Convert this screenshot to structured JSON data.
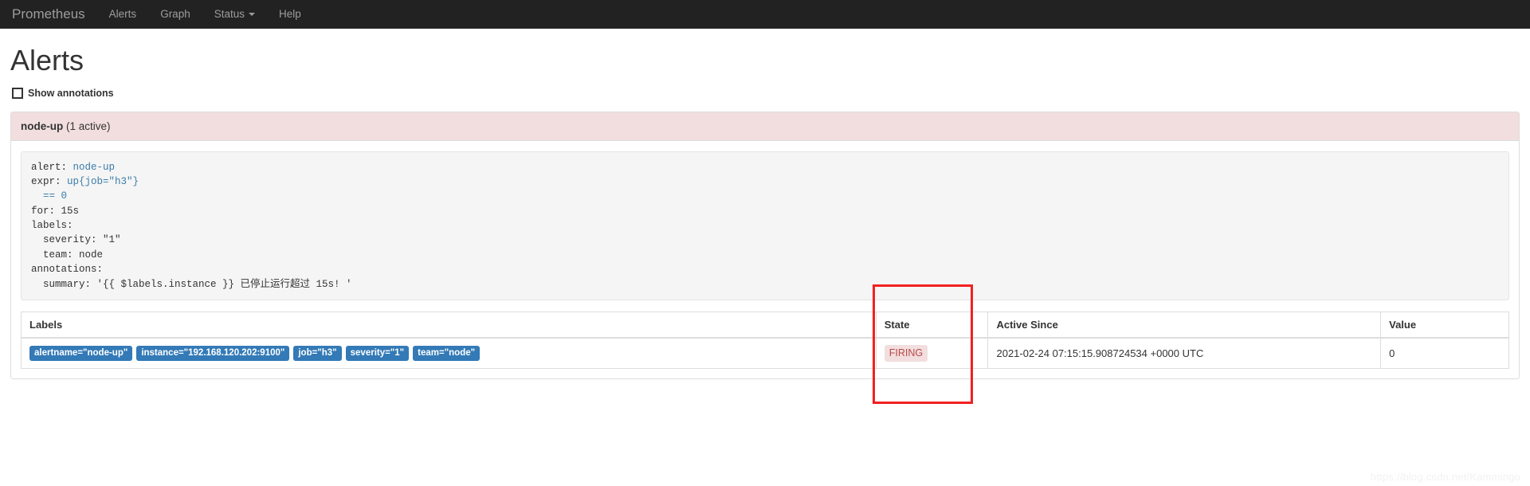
{
  "navbar": {
    "brand": "Prometheus",
    "items": [
      {
        "label": "Alerts",
        "has_caret": false
      },
      {
        "label": "Graph",
        "has_caret": false
      },
      {
        "label": "Status",
        "has_caret": true
      },
      {
        "label": "Help",
        "has_caret": false
      }
    ],
    "background_color": "#222222",
    "link_color": "#9d9d9d"
  },
  "page": {
    "title": "Alerts",
    "show_annotations_label": "Show annotations",
    "show_annotations_checked": false
  },
  "alert_group": {
    "rule_name": "node-up",
    "active_text": "(1 active)",
    "heading_background": "#f2dede",
    "rule_definition": {
      "lines": [
        {
          "key": "alert: ",
          "value": "node-up"
        },
        {
          "key": "expr: ",
          "value": "up{job=\"h3\"}"
        },
        {
          "key": "  ",
          "value": "== 0"
        },
        {
          "key": "for: 15s",
          "value": ""
        },
        {
          "key": "labels:",
          "value": ""
        },
        {
          "key": "  severity: \"1\"",
          "value": ""
        },
        {
          "key": "  team: node",
          "value": ""
        },
        {
          "key": "annotations:",
          "value": ""
        },
        {
          "key": "  summary: '{{ $labels.instance }} 已停止运行超过 15s! '",
          "value": ""
        }
      ],
      "value_color": "#3a7ca8"
    },
    "table": {
      "headers": [
        "Labels",
        "State",
        "Active Since",
        "Value"
      ],
      "rows": [
        {
          "labels": [
            "alertname=\"node-up\"",
            "instance=\"192.168.120.202:9100\"",
            "job=\"h3\"",
            "severity=\"1\"",
            "team=\"node\""
          ],
          "state": "FIRING",
          "state_color": "#b94a48",
          "state_background": "#f2dede",
          "active_since": "2021-02-24 07:15:15.908724534 +0000 UTC",
          "value": "0"
        }
      ],
      "label_badge_color": "#337ab7"
    }
  },
  "annotation_overlay": {
    "color": "#f32020",
    "target": "state-column"
  },
  "watermark": {
    "text": "https://blog.csdn.net/Kammingo"
  }
}
